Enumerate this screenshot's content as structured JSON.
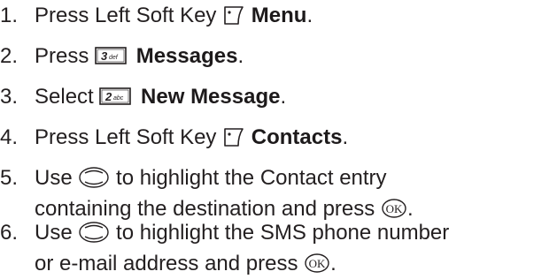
{
  "steps": [
    {
      "number": "1.",
      "text_before": "Press Left Soft Key",
      "icon": "left-soft-key-icon",
      "bold_text": "Menu",
      "text_after": "."
    },
    {
      "number": "2.",
      "text_before": "Press",
      "key_digit": "3",
      "key_letters": "def",
      "bold_text": "Messages",
      "text_after": "."
    },
    {
      "number": "3.",
      "text_before": "Select",
      "key_digit": "2",
      "key_letters": "abc",
      "bold_text": "New Message",
      "text_after": "."
    },
    {
      "number": "4.",
      "text_before": "Press Left Soft Key",
      "icon": "left-soft-key-icon",
      "bold_text": "Contacts",
      "text_after": "."
    },
    {
      "number": "5.",
      "line1_before": "Use",
      "line1_icon": "navigation-key-icon",
      "line1_after": "to highlight the Contact entry",
      "line2_before": "containing the destination and press",
      "line2_icon": "ok-key-icon",
      "line2_after": "."
    },
    {
      "number": "6.",
      "line1_before": "Use",
      "line1_icon": "navigation-key-icon",
      "line1_after": "to highlight the SMS phone number",
      "line2_before": "or e-mail address and press",
      "line2_icon": "ok-key-icon",
      "line2_after": "."
    }
  ],
  "icon_ok_label": "OK"
}
